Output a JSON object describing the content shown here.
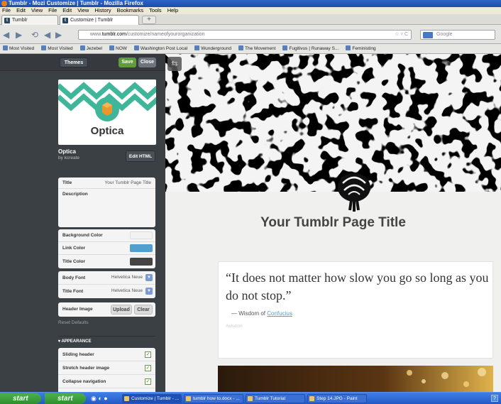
{
  "window": {
    "title": "Tumblr - Mozi Customize | Tumblr - Mozilla Firefox"
  },
  "menubar": {
    "items": [
      "File",
      "Edit",
      "View",
      "File",
      "Edit",
      "View",
      "History",
      "Bookmarks",
      "Tools",
      "Help"
    ]
  },
  "tabs": [
    {
      "label": "Tumblr"
    },
    {
      "label": "Customize | Tumblr"
    }
  ],
  "newtab_label": "+",
  "navbar": {
    "url_prefix": "www.",
    "url_domain": "tumblr.com",
    "url_path": "/customize/nameofyourorganization",
    "search_placeholder": "Google"
  },
  "bookmarks": [
    "Most Visited",
    "Most Visited",
    "Jezebel",
    "NOW",
    "Washington Post Local",
    "Wunderground",
    "The Movement",
    "Fugitivus | Runaway S...",
    "Feministing"
  ],
  "sidebar": {
    "themes_label": "Themes",
    "save_label": "Save",
    "close_label": "Close",
    "theme_name": "Optica",
    "theme_title": "Optica",
    "theme_author": "by kcreate",
    "edit_html_label": "Edit HTML",
    "title_label": "Title",
    "title_value": "Your Tumblr Page Title",
    "description_label": "Description",
    "bg_color_label": "Background Color",
    "link_color_label": "Link Color",
    "title_color_label": "Title Color",
    "body_font_label": "Body Font",
    "body_font_value": "Helvetica Neue",
    "title_font_label": "Title Font",
    "title_font_value": "Helvetica Neue",
    "header_image_label": "Header Image",
    "upload_label": "Upload",
    "clear_label": "Clear",
    "reset_defaults": "Reset Defaults",
    "appearance_label": "APPEARANCE",
    "sliding_header": "Sliding header",
    "stretch_header": "Stretch header image",
    "collapse_nav": "Collapse navigation"
  },
  "colors": {
    "background": "#f2f2f2",
    "link": "#529ecc",
    "title": "#444444"
  },
  "blog": {
    "title": "Your Tumblr Page Title",
    "quote": "“It does not matter how slow you go so long as you do not stop.”",
    "source_prefix": "— Wisdom of",
    "source_link": "Confucius",
    "tag": "#wisdom"
  },
  "taskbar": {
    "start1": "start",
    "start2": "start",
    "tasks": [
      "Customize | Tumblr - ...",
      "tumblr how to.docx - ...",
      "Tumblr Tutorial",
      "Step 14.JPG - Paint"
    ]
  }
}
